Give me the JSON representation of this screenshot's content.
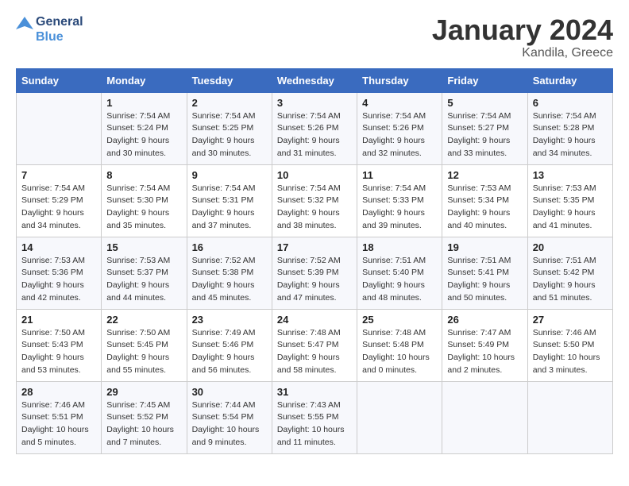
{
  "header": {
    "logo_line1": "General",
    "logo_line2": "Blue",
    "month_year": "January 2024",
    "location": "Kandila, Greece"
  },
  "weekdays": [
    "Sunday",
    "Monday",
    "Tuesday",
    "Wednesday",
    "Thursday",
    "Friday",
    "Saturday"
  ],
  "weeks": [
    [
      {
        "day": "",
        "info": ""
      },
      {
        "day": "1",
        "info": "Sunrise: 7:54 AM\nSunset: 5:24 PM\nDaylight: 9 hours\nand 30 minutes."
      },
      {
        "day": "2",
        "info": "Sunrise: 7:54 AM\nSunset: 5:25 PM\nDaylight: 9 hours\nand 30 minutes."
      },
      {
        "day": "3",
        "info": "Sunrise: 7:54 AM\nSunset: 5:26 PM\nDaylight: 9 hours\nand 31 minutes."
      },
      {
        "day": "4",
        "info": "Sunrise: 7:54 AM\nSunset: 5:26 PM\nDaylight: 9 hours\nand 32 minutes."
      },
      {
        "day": "5",
        "info": "Sunrise: 7:54 AM\nSunset: 5:27 PM\nDaylight: 9 hours\nand 33 minutes."
      },
      {
        "day": "6",
        "info": "Sunrise: 7:54 AM\nSunset: 5:28 PM\nDaylight: 9 hours\nand 34 minutes."
      }
    ],
    [
      {
        "day": "7",
        "info": "Sunrise: 7:54 AM\nSunset: 5:29 PM\nDaylight: 9 hours\nand 34 minutes."
      },
      {
        "day": "8",
        "info": "Sunrise: 7:54 AM\nSunset: 5:30 PM\nDaylight: 9 hours\nand 35 minutes."
      },
      {
        "day": "9",
        "info": "Sunrise: 7:54 AM\nSunset: 5:31 PM\nDaylight: 9 hours\nand 37 minutes."
      },
      {
        "day": "10",
        "info": "Sunrise: 7:54 AM\nSunset: 5:32 PM\nDaylight: 9 hours\nand 38 minutes."
      },
      {
        "day": "11",
        "info": "Sunrise: 7:54 AM\nSunset: 5:33 PM\nDaylight: 9 hours\nand 39 minutes."
      },
      {
        "day": "12",
        "info": "Sunrise: 7:53 AM\nSunset: 5:34 PM\nDaylight: 9 hours\nand 40 minutes."
      },
      {
        "day": "13",
        "info": "Sunrise: 7:53 AM\nSunset: 5:35 PM\nDaylight: 9 hours\nand 41 minutes."
      }
    ],
    [
      {
        "day": "14",
        "info": "Sunrise: 7:53 AM\nSunset: 5:36 PM\nDaylight: 9 hours\nand 42 minutes."
      },
      {
        "day": "15",
        "info": "Sunrise: 7:53 AM\nSunset: 5:37 PM\nDaylight: 9 hours\nand 44 minutes."
      },
      {
        "day": "16",
        "info": "Sunrise: 7:52 AM\nSunset: 5:38 PM\nDaylight: 9 hours\nand 45 minutes."
      },
      {
        "day": "17",
        "info": "Sunrise: 7:52 AM\nSunset: 5:39 PM\nDaylight: 9 hours\nand 47 minutes."
      },
      {
        "day": "18",
        "info": "Sunrise: 7:51 AM\nSunset: 5:40 PM\nDaylight: 9 hours\nand 48 minutes."
      },
      {
        "day": "19",
        "info": "Sunrise: 7:51 AM\nSunset: 5:41 PM\nDaylight: 9 hours\nand 50 minutes."
      },
      {
        "day": "20",
        "info": "Sunrise: 7:51 AM\nSunset: 5:42 PM\nDaylight: 9 hours\nand 51 minutes."
      }
    ],
    [
      {
        "day": "21",
        "info": "Sunrise: 7:50 AM\nSunset: 5:43 PM\nDaylight: 9 hours\nand 53 minutes."
      },
      {
        "day": "22",
        "info": "Sunrise: 7:50 AM\nSunset: 5:45 PM\nDaylight: 9 hours\nand 55 minutes."
      },
      {
        "day": "23",
        "info": "Sunrise: 7:49 AM\nSunset: 5:46 PM\nDaylight: 9 hours\nand 56 minutes."
      },
      {
        "day": "24",
        "info": "Sunrise: 7:48 AM\nSunset: 5:47 PM\nDaylight: 9 hours\nand 58 minutes."
      },
      {
        "day": "25",
        "info": "Sunrise: 7:48 AM\nSunset: 5:48 PM\nDaylight: 10 hours\nand 0 minutes."
      },
      {
        "day": "26",
        "info": "Sunrise: 7:47 AM\nSunset: 5:49 PM\nDaylight: 10 hours\nand 2 minutes."
      },
      {
        "day": "27",
        "info": "Sunrise: 7:46 AM\nSunset: 5:50 PM\nDaylight: 10 hours\nand 3 minutes."
      }
    ],
    [
      {
        "day": "28",
        "info": "Sunrise: 7:46 AM\nSunset: 5:51 PM\nDaylight: 10 hours\nand 5 minutes."
      },
      {
        "day": "29",
        "info": "Sunrise: 7:45 AM\nSunset: 5:52 PM\nDaylight: 10 hours\nand 7 minutes."
      },
      {
        "day": "30",
        "info": "Sunrise: 7:44 AM\nSunset: 5:54 PM\nDaylight: 10 hours\nand 9 minutes."
      },
      {
        "day": "31",
        "info": "Sunrise: 7:43 AM\nSunset: 5:55 PM\nDaylight: 10 hours\nand 11 minutes."
      },
      {
        "day": "",
        "info": ""
      },
      {
        "day": "",
        "info": ""
      },
      {
        "day": "",
        "info": ""
      }
    ]
  ]
}
